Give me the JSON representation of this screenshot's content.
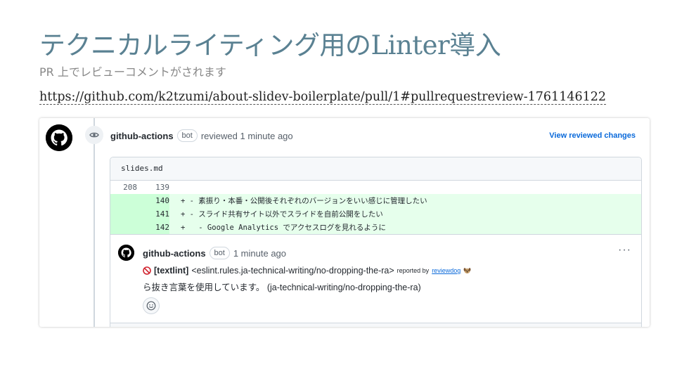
{
  "slide": {
    "title": "テクニカルライティング用のLinter導入",
    "subtitle": "PR 上でレビューコメントがされます",
    "link": "https://github.com/k2tzumi/about-slidev-boilerplate/pull/1#pullrequestreview-1761146122"
  },
  "review": {
    "author": "github-actions",
    "badge": "bot",
    "action_time": "reviewed 1 minute ago",
    "view_changes": "View reviewed changes",
    "file_name": "slides.md",
    "diff_lines": [
      {
        "old": "208",
        "new": "139",
        "text": ""
      },
      {
        "old": "",
        "new": "140",
        "text": "+ - 素振り・本番・公開後それぞれのバージョンをいい感じに管理したい"
      },
      {
        "old": "",
        "new": "141",
        "text": "+ - スライド共有サイト以外でスライドを自前公開をしたい"
      },
      {
        "old": "",
        "new": "142",
        "text": "+   - Google Analytics でアクセスログを見れるように"
      }
    ],
    "comment": {
      "author": "github-actions",
      "badge": "bot",
      "time": "1 minute ago",
      "more": "···",
      "rule": "[textlint]",
      "rule_id": "<eslint.rules.ja-technical-writing/no-dropping-the-ra>",
      "reported_by": "reported by",
      "reporter": "reviewdog",
      "message": "ら抜き言葉を使用しています。 (ja-technical-writing/no-dropping-the-ra)"
    }
  },
  "colors": {
    "title": "#5a8192",
    "link": "#0969da",
    "added_bg": "#e6ffec"
  }
}
